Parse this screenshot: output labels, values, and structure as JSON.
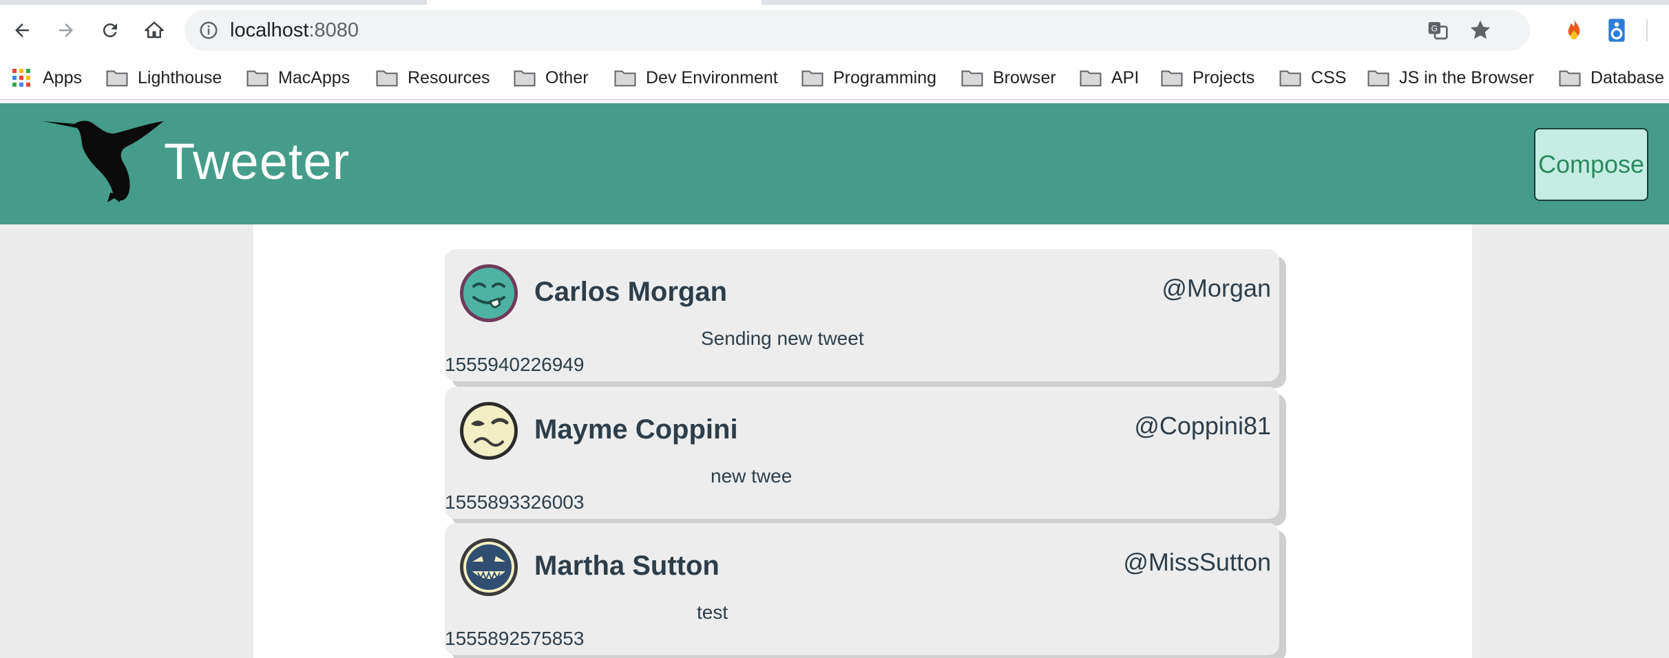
{
  "browser": {
    "url_host": "localhost",
    "url_port": ":8080",
    "bookmarks": [
      {
        "label": "Apps",
        "icon": "apps-grid-icon"
      },
      {
        "label": "Lighthouse",
        "icon": "folder-icon"
      },
      {
        "label": "MacApps",
        "icon": "folder-icon"
      },
      {
        "label": "Resources",
        "icon": "folder-icon"
      },
      {
        "label": "Other",
        "icon": "folder-icon"
      },
      {
        "label": "Dev Environment",
        "icon": "folder-icon"
      },
      {
        "label": "Programming",
        "icon": "folder-icon"
      },
      {
        "label": "Browser",
        "icon": "folder-icon"
      },
      {
        "label": "API",
        "icon": "folder-icon"
      },
      {
        "label": "Projects",
        "icon": "folder-icon"
      },
      {
        "label": "CSS",
        "icon": "folder-icon"
      },
      {
        "label": "JS in the Browser",
        "icon": "folder-icon"
      },
      {
        "label": "Database",
        "icon": "folder-icon"
      }
    ]
  },
  "app": {
    "title": "Tweeter",
    "compose_label": "Compose",
    "header_color": "#459d89"
  },
  "tweets": [
    {
      "name": "Carlos Morgan",
      "handle": "@Morgan",
      "text": "Sending new tweet",
      "timestamp": "1555940226949",
      "avatar": "tongue-out-face-icon"
    },
    {
      "name": "Mayme Coppini",
      "handle": "@Coppini81",
      "text": "new twee",
      "timestamp": "1555893326003",
      "avatar": "wink-face-icon"
    },
    {
      "name": "Martha Sutton",
      "handle": "@MissSutton",
      "text": "test",
      "timestamp": "1555892575853",
      "avatar": "grin-face-icon"
    }
  ]
}
